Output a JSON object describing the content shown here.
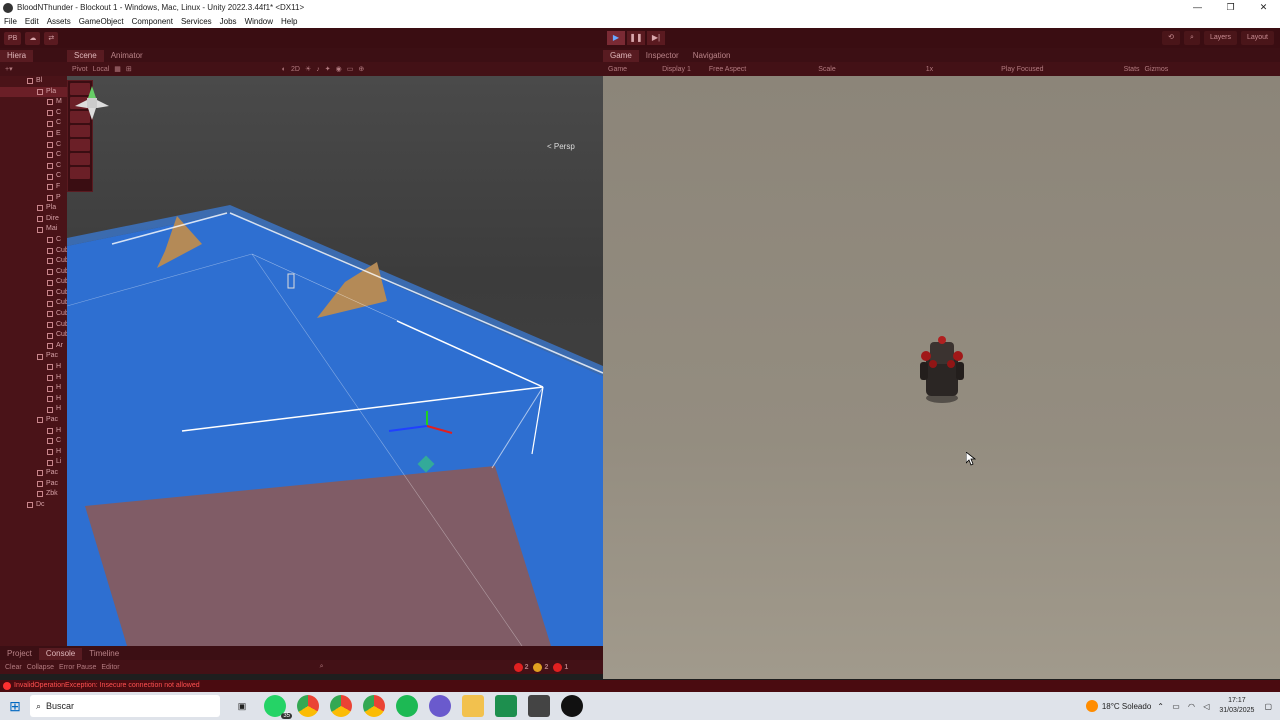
{
  "window": {
    "title": "BloodNThunder - Blockout 1 - Windows, Mac, Linux - Unity 2022.3.44f1* <DX11>",
    "controls": [
      "—",
      "❐",
      "✕"
    ]
  },
  "menu": [
    "File",
    "Edit",
    "Assets",
    "GameObject",
    "Component",
    "Services",
    "Jobs",
    "Window",
    "Help"
  ],
  "toolbar": {
    "account": "PB",
    "layers": "Layers",
    "layout": "Layout"
  },
  "hierarchy": {
    "tab": "Hiera",
    "items": [
      "Bl",
      "Pla",
      "M",
      "C",
      "C",
      "E",
      "C",
      "C",
      "C",
      "C",
      "F",
      "P",
      "Pla",
      "Dire",
      "Mai",
      "C",
      "Cub",
      "Cub",
      "Cub",
      "Cub",
      "Cub",
      "Cub",
      "Cub",
      "Cub",
      "Cub",
      "Ar",
      "Pac",
      "H",
      "H",
      "H",
      "H",
      "H",
      "Pac",
      "H",
      "C",
      "H",
      "Li",
      "Pac",
      "Pac",
      "Zbk",
      "Dc"
    ]
  },
  "scene": {
    "tabs": [
      "Scene",
      "Animator"
    ],
    "pivot": "Pivot",
    "local": "Local",
    "mode": "2D",
    "persp": "< Persp"
  },
  "game": {
    "tabs": [
      "Game",
      "Inspector",
      "Navigation"
    ],
    "display_type": "Game",
    "display": "Display 1",
    "aspect": "Free Aspect",
    "scale_label": "Scale",
    "scale_value": "1x",
    "play_focused": "Play Focused",
    "stats": "Stats",
    "gizmos": "Gizmos"
  },
  "console": {
    "tabs": [
      "Project",
      "Console",
      "Timeline"
    ],
    "buttons": [
      "Clear",
      "Collapse",
      "Error Pause",
      "Editor"
    ],
    "errors": "2",
    "warnings": "2",
    "messages": "1",
    "status_error": "InvalidOperationException: Insecure connection not allowed"
  },
  "taskbar": {
    "search": "Buscar",
    "weather": "18°C  Soleado",
    "time": "17:17",
    "date": "31/03/2025",
    "whatsapp_badge": "35"
  }
}
